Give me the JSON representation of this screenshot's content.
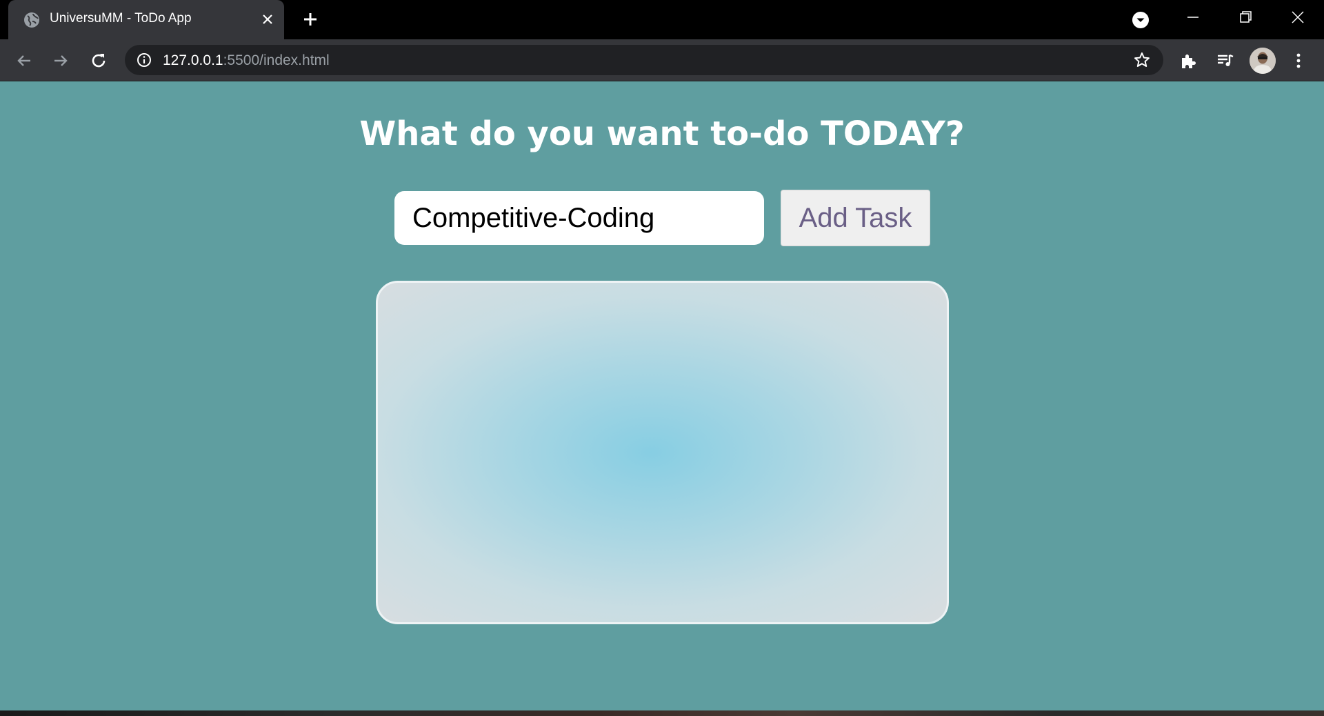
{
  "browser": {
    "tab": {
      "title": "UniversuMM - ToDo App",
      "favicon": "globe-icon"
    },
    "address_bar": {
      "host": "127.0.0.1",
      "path": ":5500/index.html"
    },
    "colors": {
      "tabbar_bg": "#000000",
      "toolbar_bg": "#35363a",
      "omnibox_bg": "#202124"
    }
  },
  "app": {
    "heading": "What do you want to-do TODAY?",
    "task_input": {
      "value": "Competitive-Coding"
    },
    "add_button_label": "Add Task",
    "colors": {
      "page_bg": "#5f9ea0",
      "button_text": "#6a5f86",
      "list_center": "#87cee3"
    }
  }
}
